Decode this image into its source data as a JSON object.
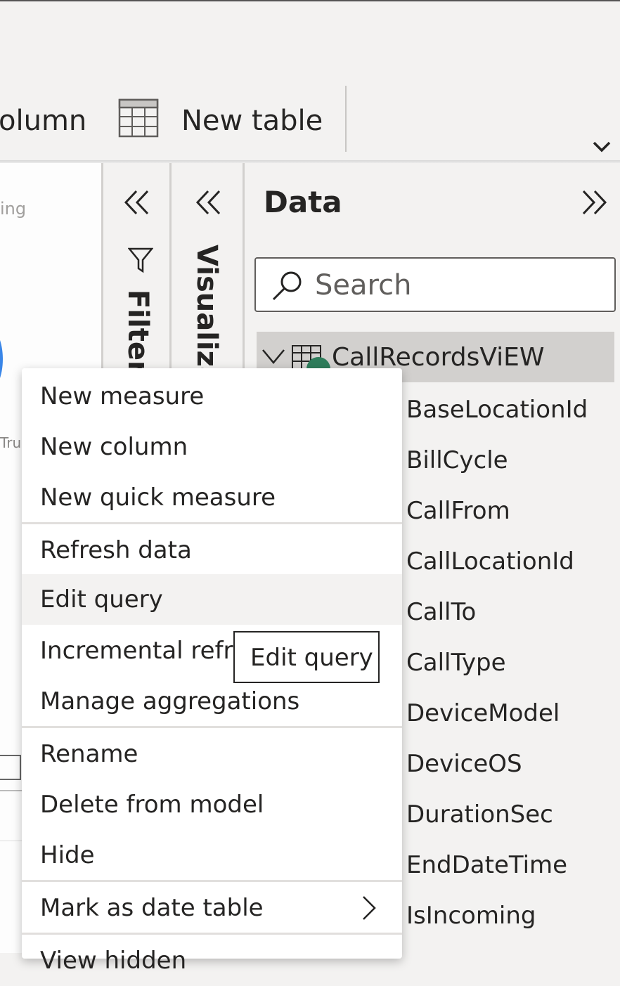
{
  "ribbon": {
    "column_label": "olumn",
    "new_table_label": "New table"
  },
  "canvas": {
    "hint_text": "ing",
    "true_text": "Tru"
  },
  "filters_pane": {
    "label": "Filters"
  },
  "visualizations_pane": {
    "label": "Visualizations"
  },
  "data_pane": {
    "title": "Data",
    "search": {
      "placeholder": "Search"
    },
    "table": {
      "name": "CallRecordsViEW",
      "fields": [
        "BaseLocationId",
        "BillCycle",
        "CallFrom",
        "CallLocationId",
        "CallTo",
        "CallType",
        "DeviceModel",
        "DeviceOS",
        "DurationSec",
        "EndDateTime",
        "IsIncoming"
      ]
    }
  },
  "context_menu": {
    "items": [
      "New measure",
      "New column",
      "New quick measure",
      "Refresh data",
      "Edit query",
      "Incremental refresh",
      "Manage aggregations",
      "Rename",
      "Delete from model",
      "Hide",
      "Mark as date table",
      "View hidden"
    ],
    "hovered_item": "Edit query"
  },
  "tooltip": {
    "text": "Edit query"
  },
  "colors": {
    "background": "#f3f2f1",
    "selected_row": "#d2d0ce",
    "menu_background": "#ffffff",
    "accent_circle": "#3a86e8",
    "badge": "#2e7d5b"
  }
}
